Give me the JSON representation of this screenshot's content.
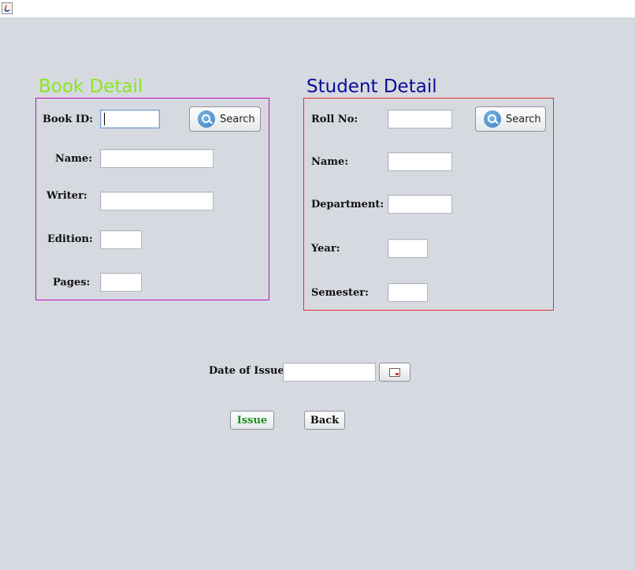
{
  "window": {
    "icon": "java-icon"
  },
  "book": {
    "heading": "Book Detail",
    "heading_color": "#8ae61c",
    "border_color": "#c010c0",
    "fields": {
      "book_id": {
        "label": "Book ID:",
        "value": ""
      },
      "name": {
        "label": "Name:",
        "value": ""
      },
      "writer": {
        "label": "Writer:",
        "value": ""
      },
      "edition": {
        "label": "Edition:",
        "value": ""
      },
      "pages": {
        "label": "Pages:",
        "value": ""
      }
    },
    "search_label": "Search"
  },
  "student": {
    "heading": "Student Detail",
    "heading_color": "#0a0a9a",
    "border_color": "#e62e2e",
    "fields": {
      "roll_no": {
        "label": "Roll No:",
        "value": ""
      },
      "name": {
        "label": "Name:",
        "value": ""
      },
      "department": {
        "label": "Department:",
        "value": ""
      },
      "year": {
        "label": "Year:",
        "value": ""
      },
      "semester": {
        "label": "Semester:",
        "value": ""
      }
    },
    "search_label": "Search"
  },
  "issue_date": {
    "label": "Date of Issue:",
    "value": "",
    "icon": "calendar-icon"
  },
  "actions": {
    "issue_label": "Issue",
    "issue_color": "#1f8f1f",
    "back_label": "Back",
    "back_color": "#111111"
  }
}
